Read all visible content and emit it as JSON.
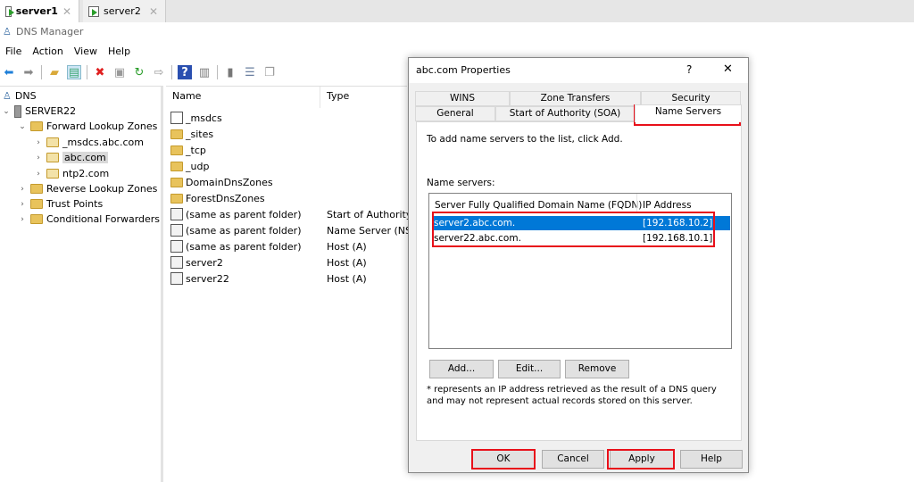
{
  "vm_tabs": [
    {
      "label": "server1",
      "active": true
    },
    {
      "label": "server2",
      "active": false
    }
  ],
  "app": {
    "title": "DNS Manager"
  },
  "menu": [
    "File",
    "Action",
    "View",
    "Help"
  ],
  "toolbar_icons": [
    "back-icon",
    "forward-icon",
    "up-folder-icon",
    "show-console-tree-icon",
    "delete-icon",
    "properties-icon",
    "refresh-icon",
    "export-icon",
    "help-icon",
    "action-pane-icon",
    "server-icon",
    "zone-icon",
    "copy-icon"
  ],
  "tree": [
    {
      "label": "DNS",
      "level": 0,
      "icon": "dns-icon",
      "chev": ""
    },
    {
      "label": "SERVER22",
      "level": 1,
      "icon": "server-icon",
      "chev": "⌄"
    },
    {
      "label": "Forward Lookup Zones",
      "level": 2,
      "icon": "folder-icon",
      "chev": "⌄"
    },
    {
      "label": "_msdcs.abc.com",
      "level": 3,
      "icon": "zone-icon",
      "chev": "›"
    },
    {
      "label": "abc.com",
      "level": 3,
      "icon": "zone-icon",
      "chev": "›",
      "selected": true
    },
    {
      "label": "ntp2.com",
      "level": 3,
      "icon": "zone-icon",
      "chev": "›"
    },
    {
      "label": "Reverse Lookup Zones",
      "level": 2,
      "icon": "folder-icon",
      "chev": "›"
    },
    {
      "label": "Trust Points",
      "level": 2,
      "icon": "folder-icon",
      "chev": "›"
    },
    {
      "label": "Conditional Forwarders",
      "level": 2,
      "icon": "folder-icon",
      "chev": "›"
    }
  ],
  "list": {
    "columns": [
      "Name",
      "Type"
    ],
    "rows": [
      {
        "name": "_msdcs",
        "type": "",
        "icon": "zone-icon"
      },
      {
        "name": "_sites",
        "type": "",
        "icon": "folder-icon"
      },
      {
        "name": "_tcp",
        "type": "",
        "icon": "folder-icon"
      },
      {
        "name": "_udp",
        "type": "",
        "icon": "folder-icon"
      },
      {
        "name": "DomainDnsZones",
        "type": "",
        "icon": "folder-icon"
      },
      {
        "name": "ForestDnsZones",
        "type": "",
        "icon": "folder-icon"
      },
      {
        "name": "(same as parent folder)",
        "type": "Start of Authority",
        "icon": "record-icon"
      },
      {
        "name": "(same as parent folder)",
        "type": "Name Server (NS)",
        "icon": "record-icon"
      },
      {
        "name": "(same as parent folder)",
        "type": "Host (A)",
        "icon": "record-icon"
      },
      {
        "name": "server2",
        "type": "Host (A)",
        "icon": "record-icon"
      },
      {
        "name": "server22",
        "type": "Host (A)",
        "icon": "record-icon"
      }
    ]
  },
  "dialog": {
    "title": "abc.com Properties",
    "help": "?",
    "close": "✕",
    "tabs_row1": [
      "WINS",
      "Zone Transfers",
      "Security"
    ],
    "tabs_row2": [
      "General",
      "Start of Authority (SOA)",
      "Name Servers"
    ],
    "active_tab": "Name Servers",
    "instruction": "To add name servers to the list, click Add.",
    "list_label": "Name servers:",
    "columns": [
      "Server Fully Qualified Domain Name (FQDN)",
      "IP Address"
    ],
    "servers": [
      {
        "fqdn": "server2.abc.com.",
        "ip": "[192.168.10.2]",
        "selected": true
      },
      {
        "fqdn": "server22.abc.com.",
        "ip": "[192.168.10.1]",
        "selected": false
      }
    ],
    "add": "Add...",
    "edit": "Edit...",
    "remove": "Remove",
    "note": "* represents an IP address retrieved as the result of a DNS query and may not represent actual records stored on this server.",
    "ok": "OK",
    "cancel": "Cancel",
    "apply": "Apply",
    "helpbtn": "Help"
  },
  "colors": {
    "selection": "#0078d7",
    "highlight_box": "#e8101a"
  }
}
